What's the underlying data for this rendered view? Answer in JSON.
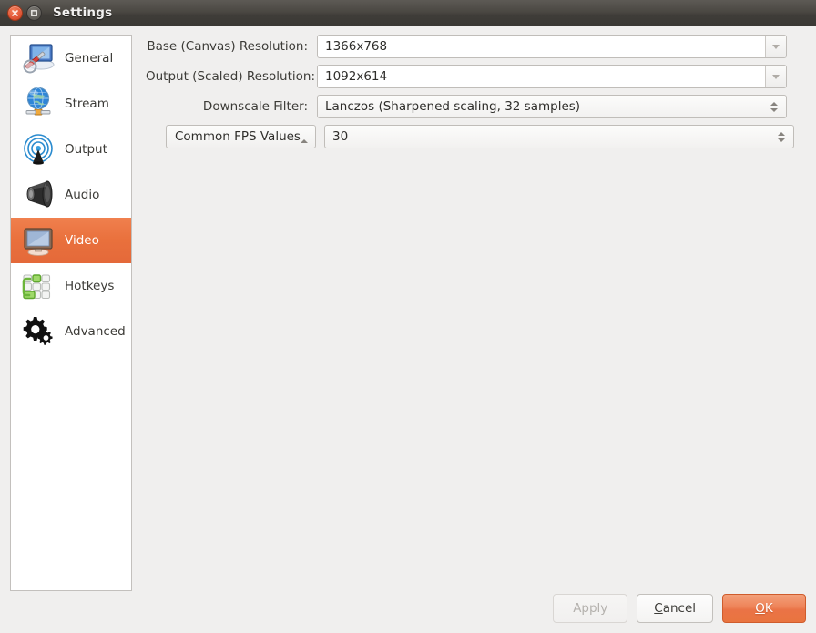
{
  "window": {
    "title": "Settings",
    "close_icon": "close-icon",
    "maximize_icon": "maximize-icon"
  },
  "sidebar": {
    "items": [
      {
        "label": "General",
        "icon": "general-icon",
        "selected": false
      },
      {
        "label": "Stream",
        "icon": "stream-icon",
        "selected": false
      },
      {
        "label": "Output",
        "icon": "output-icon",
        "selected": false
      },
      {
        "label": "Audio",
        "icon": "audio-icon",
        "selected": false
      },
      {
        "label": "Video",
        "icon": "video-icon",
        "selected": true
      },
      {
        "label": "Hotkeys",
        "icon": "hotkeys-icon",
        "selected": false
      },
      {
        "label": "Advanced",
        "icon": "advanced-icon",
        "selected": false
      }
    ]
  },
  "video_settings": {
    "base_resolution": {
      "label": "Base (Canvas) Resolution:",
      "value": "1366x768",
      "control": "combobox"
    },
    "output_resolution": {
      "label": "Output (Scaled) Resolution:",
      "value": "1092x614",
      "control": "combobox"
    },
    "downscale_filter": {
      "label": "Downscale Filter:",
      "value": "Lanczos (Sharpened scaling, 32 samples)",
      "control": "spinbox"
    },
    "fps": {
      "mode_label": "Common FPS Values",
      "value": "30",
      "control": "spinbox"
    }
  },
  "buttons": {
    "apply": {
      "label": "Apply",
      "enabled": false
    },
    "cancel": {
      "label": "Cancel",
      "accel": "C"
    },
    "ok": {
      "label": "OK",
      "accel": "O"
    }
  },
  "colors": {
    "accent": "#e9703c",
    "titlebar_top": "#5d5a55",
    "titlebar_bottom": "#3a3834",
    "window_bg": "#f0efee",
    "list_bg": "#ffffff"
  }
}
